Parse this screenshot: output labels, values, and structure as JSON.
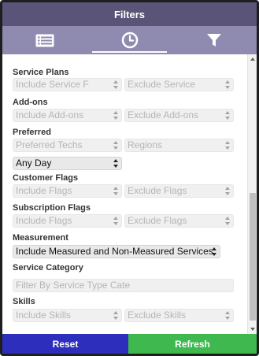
{
  "header": {
    "title": "Filters"
  },
  "tabs": [
    {
      "icon": "list-icon",
      "active": false
    },
    {
      "icon": "clock-icon",
      "active": true
    },
    {
      "icon": "filter-icon",
      "active": false
    }
  ],
  "sections": {
    "service_plans": {
      "label": "Service Plans",
      "include_placeholder": "Include Service F",
      "exclude_placeholder": "Exclude Service"
    },
    "add_ons": {
      "label": "Add-ons",
      "include_placeholder": "Include Add-ons",
      "exclude_placeholder": "Exclude Add-ons"
    },
    "preferred": {
      "label": "Preferred",
      "techs_placeholder": "Preferred Techs",
      "regions_placeholder": "Regions",
      "day_value": "Any Day"
    },
    "customer_flags": {
      "label": "Customer Flags",
      "include_placeholder": "Include Flags",
      "exclude_placeholder": "Exclude Flags"
    },
    "subscription_flags": {
      "label": "Subscription Flags",
      "include_placeholder": "Include Flags",
      "exclude_placeholder": "Exclude Flags"
    },
    "measurement": {
      "label": "Measurement",
      "value": "Include Measured and Non-Measured Services"
    },
    "service_category": {
      "label": "Service Category",
      "placeholder": "Filter By Service Type Cate"
    },
    "skills": {
      "label": "Skills",
      "include_placeholder": "Include Skills",
      "exclude_placeholder": "Exclude Skills"
    }
  },
  "footer": {
    "reset_label": "Reset",
    "refresh_label": "Refresh"
  },
  "colors": {
    "header_bg": "#5a5478",
    "tabs_bg": "#8f8ab0",
    "reset_bg": "#2e2ebc",
    "refresh_bg": "#3fb94f"
  }
}
